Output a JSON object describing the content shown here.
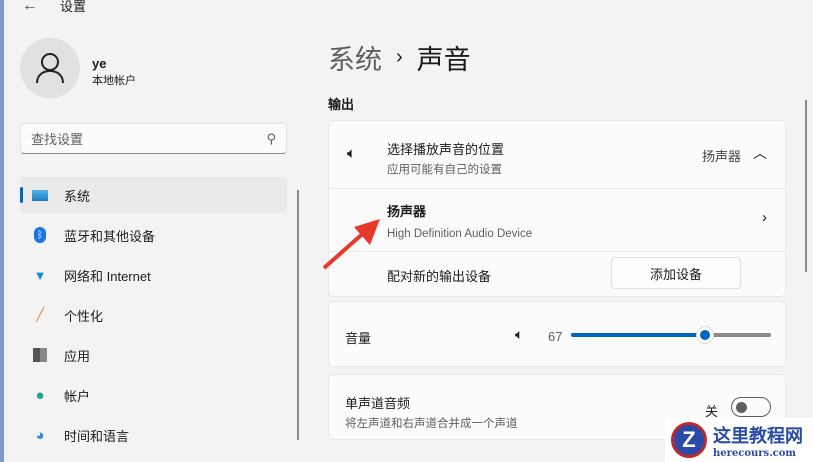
{
  "window": {
    "title": "设置"
  },
  "user": {
    "name": "ye",
    "type": "本地帐户"
  },
  "search": {
    "placeholder": "查找设置"
  },
  "sidebar": {
    "items": [
      {
        "label": "系统",
        "icon": "monitor-icon"
      },
      {
        "label": "蓝牙和其他设备",
        "icon": "bluetooth-icon"
      },
      {
        "label": "网络和 Internet",
        "icon": "wifi-icon"
      },
      {
        "label": "个性化",
        "icon": "brush-icon"
      },
      {
        "label": "应用",
        "icon": "apps-icon"
      },
      {
        "label": "帐户",
        "icon": "account-icon"
      },
      {
        "label": "时间和语言",
        "icon": "clock-globe-icon"
      }
    ]
  },
  "breadcrumb": {
    "parent": "系统",
    "separator": "›",
    "current": "声音"
  },
  "output": {
    "section": "输出",
    "choose": {
      "title": "选择播放声音的位置",
      "subtitle": "应用可能有自己的设置",
      "value": "扬声器"
    },
    "device": {
      "name": "扬声器",
      "desc": "High Definition Audio Device"
    },
    "pair": {
      "label": "配对新的输出设备",
      "button": "添加设备"
    },
    "volume": {
      "label": "音量",
      "value": "67",
      "percent": 67
    },
    "mono": {
      "title": "单声道音频",
      "subtitle": "将左声道和右声道合并成一个声道",
      "state": "关"
    }
  },
  "watermark": {
    "name": "这里教程网",
    "url": "herecours.com"
  },
  "colors": {
    "accent": "#0067c0",
    "arrow": "#e8382b"
  }
}
